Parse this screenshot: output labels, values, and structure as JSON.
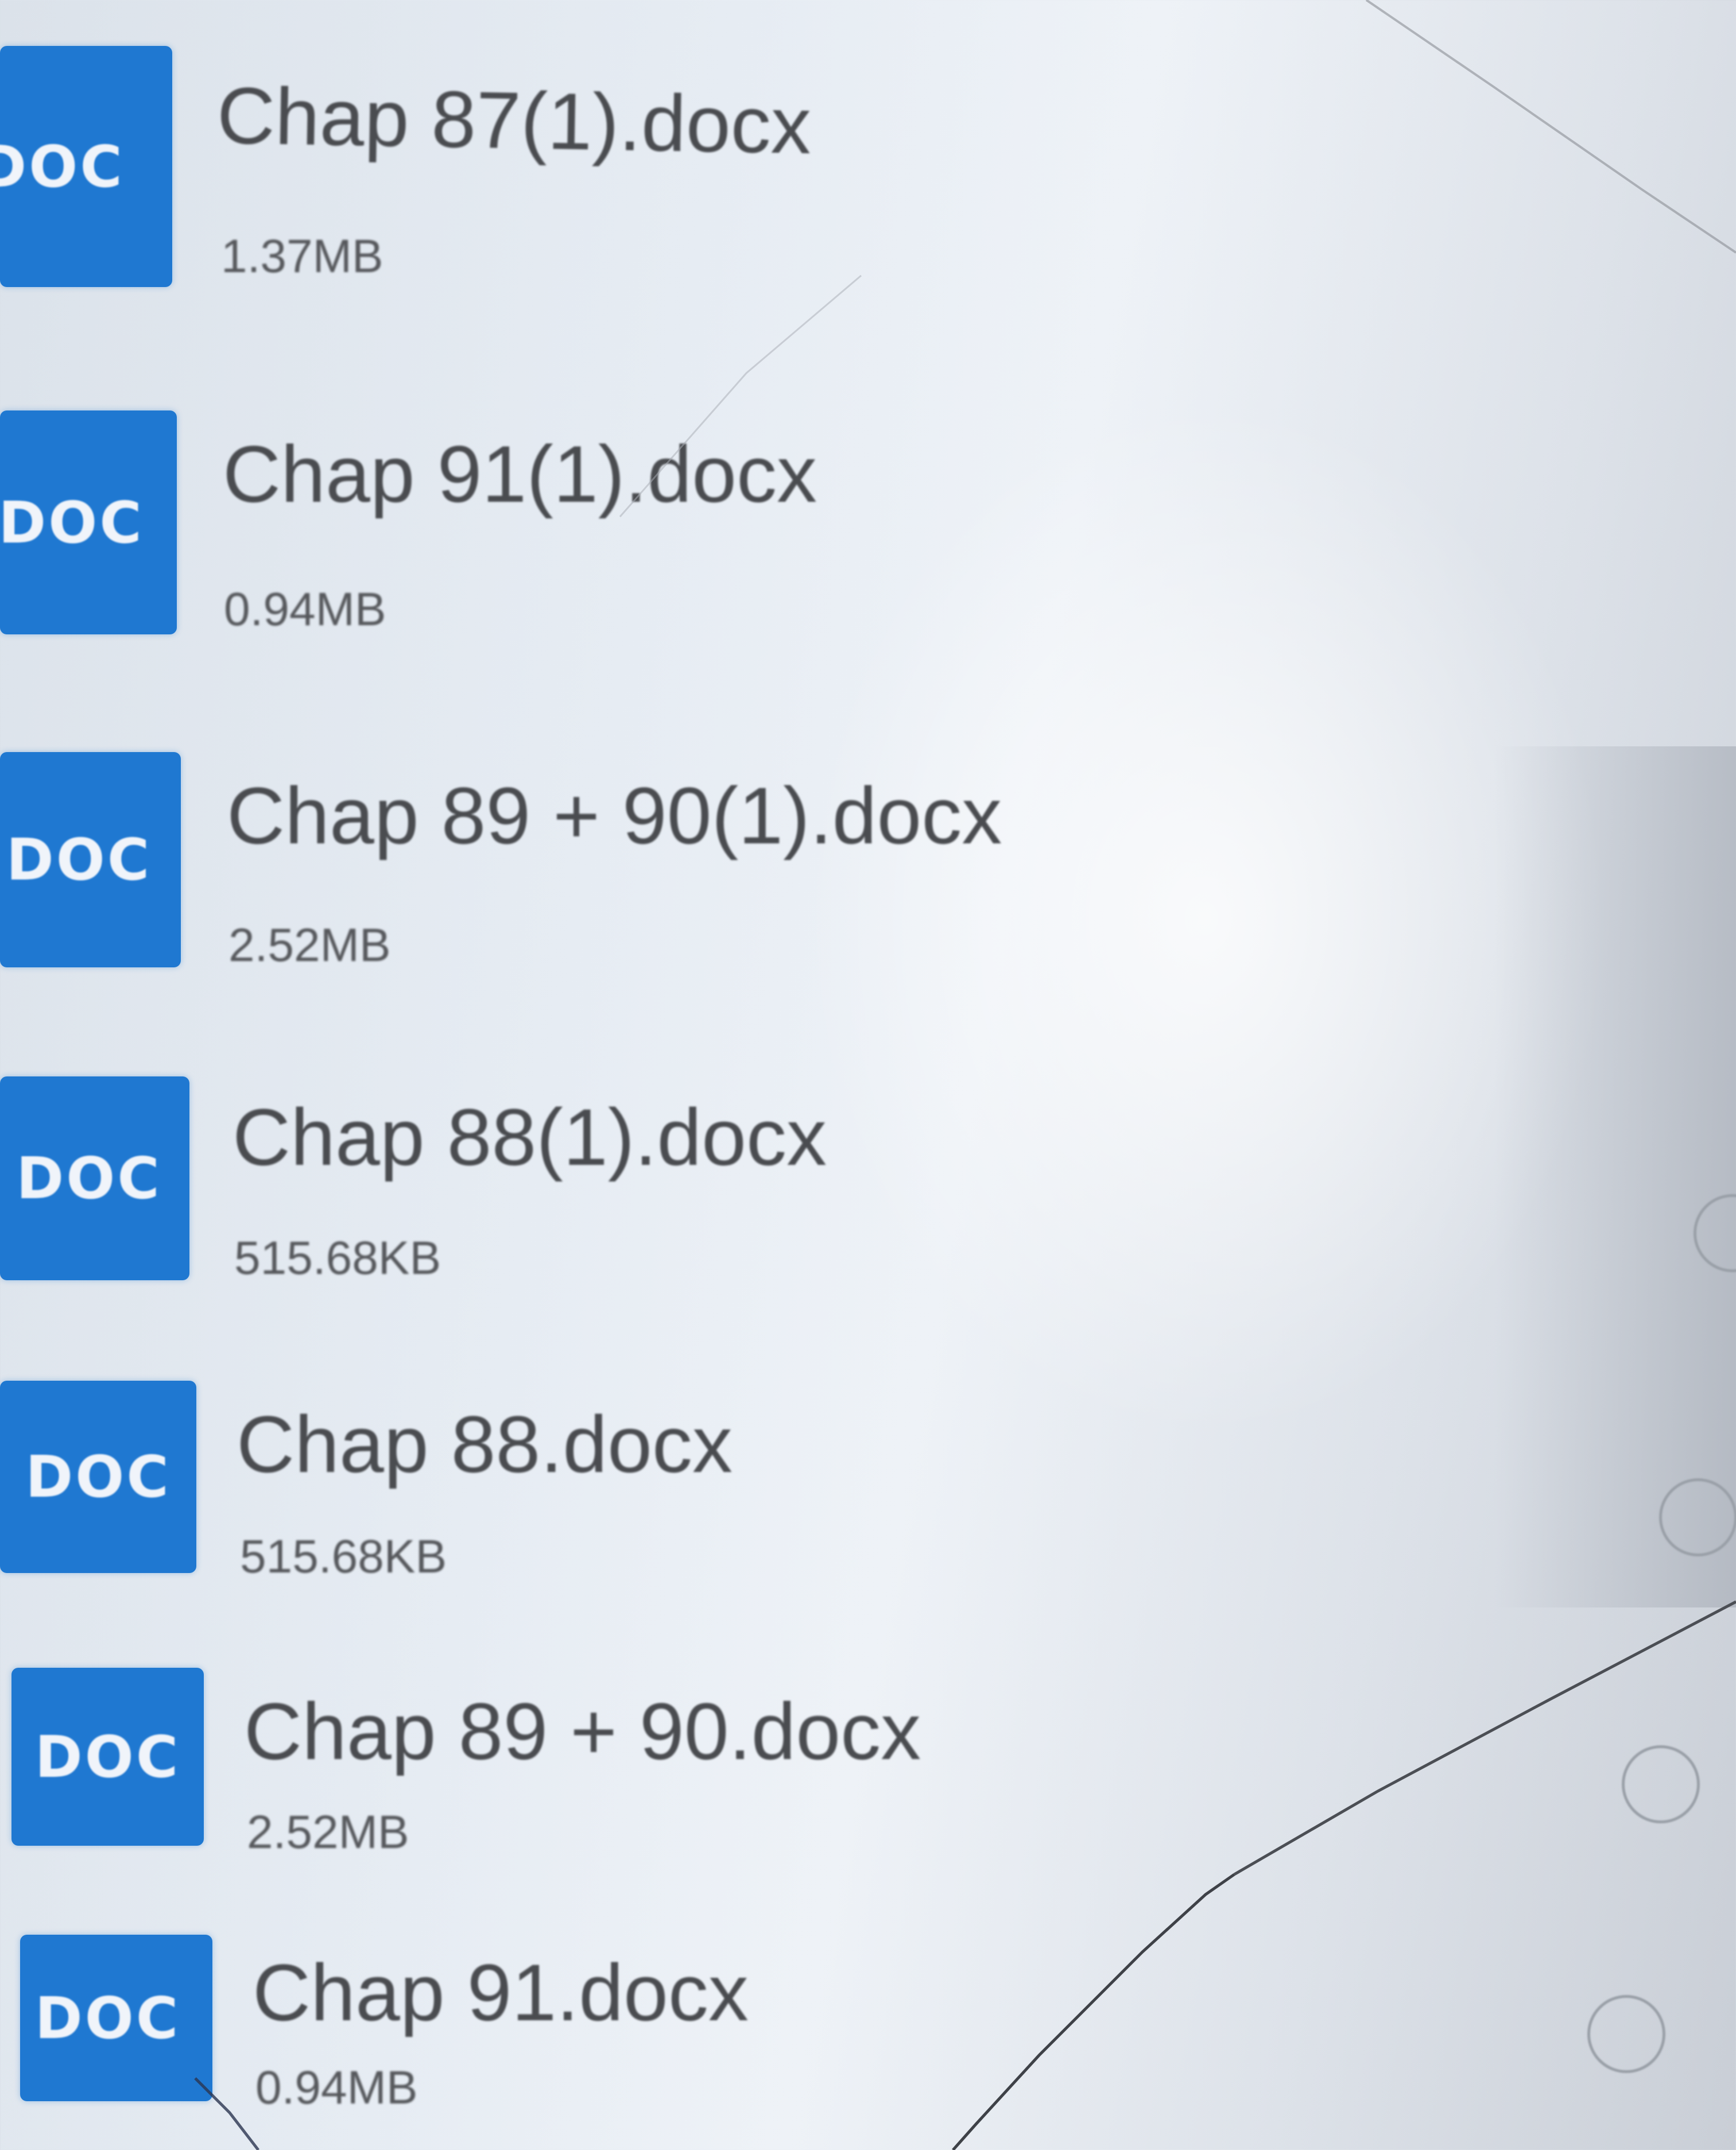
{
  "files": [
    {
      "icon_label": "DOC",
      "name": "Chap 87(1).docx",
      "size": "1.37MB"
    },
    {
      "icon_label": "DOC",
      "name": "Chap 91(1).docx",
      "size": "0.94MB"
    },
    {
      "icon_label": "DOC",
      "name": "Chap 89 + 90(1).docx",
      "size": "2.52MB"
    },
    {
      "icon_label": "DOC",
      "name": "Chap 88(1).docx",
      "size": "515.68KB"
    },
    {
      "icon_label": "DOC",
      "name": "Chap 88.docx",
      "size": "515.68KB"
    },
    {
      "icon_label": "DOC",
      "name": "Chap 89 + 90.docx",
      "size": "2.52MB"
    },
    {
      "icon_label": "DOC",
      "name": "Chap 91.docx",
      "size": "0.94MB"
    }
  ],
  "colors": {
    "doc_icon": "#1f78d1",
    "text": "#4a4c50"
  }
}
